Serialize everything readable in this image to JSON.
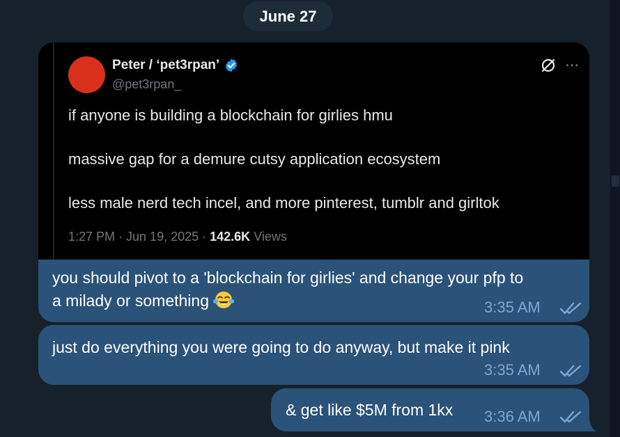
{
  "date_separator": "June 27",
  "tweet": {
    "author_name": "Peter / ‘pet3rpan’",
    "handle": "@pet3rpan_",
    "lines": [
      "if anyone is building a blockchain for girlies hmu",
      "massive gap for a demure cutsy application ecosystem",
      "less male nerd tech incel, and more pinterest, tumblr and girltok"
    ],
    "time": "1:27 PM · Jun 19, 2025 · ",
    "views_count": "142.6K",
    "views_label": "Views",
    "avatar_color": "#d8301a",
    "verified_color": "#1d9bf0"
  },
  "messages": [
    {
      "line1": "you should pivot to a 'blockchain for girlies' and change your pfp to",
      "line2": "a milady or something",
      "emoji": "face-with-tears-of-joy",
      "time": "3:35 AM"
    },
    {
      "line1": "just do everything you were going to do anyway, but make it pink",
      "time": "3:35 AM"
    },
    {
      "line1": "& get like $5M from 1kx",
      "time": "3:36 AM"
    }
  ],
  "colors": {
    "background": "#17212b",
    "bubble": "#2b5278",
    "meta": "#7da8d3"
  }
}
